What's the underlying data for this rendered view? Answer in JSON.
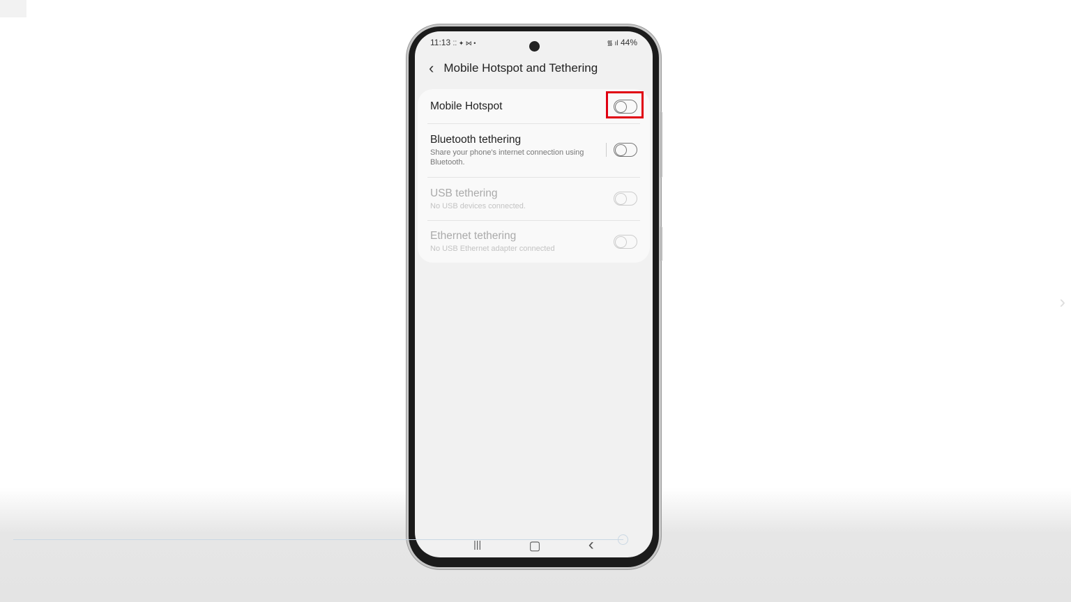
{
  "status_bar": {
    "time": "11:13",
    "notif_icons": "⁚⁚ ✦ ⋈ •",
    "signal": "wifi-icon signal-icon",
    "battery": "44%"
  },
  "header": {
    "title": "Mobile Hotspot and Tethering"
  },
  "settings": [
    {
      "title": "Mobile Hotspot",
      "subtitle": "",
      "enabled": true,
      "on": false
    },
    {
      "title": "Bluetooth tethering",
      "subtitle": "Share your phone's internet connection using Bluetooth.",
      "enabled": true,
      "on": false
    },
    {
      "title": "USB tethering",
      "subtitle": "No USB devices connected.",
      "enabled": false,
      "on": false
    },
    {
      "title": "Ethernet tethering",
      "subtitle": "No USB Ethernet adapter connected",
      "enabled": false,
      "on": false
    }
  ],
  "highlight_color": "#e00012",
  "nav": {
    "recents": "|||",
    "home": "▢",
    "back": "‹"
  },
  "video": {
    "next": "›"
  }
}
